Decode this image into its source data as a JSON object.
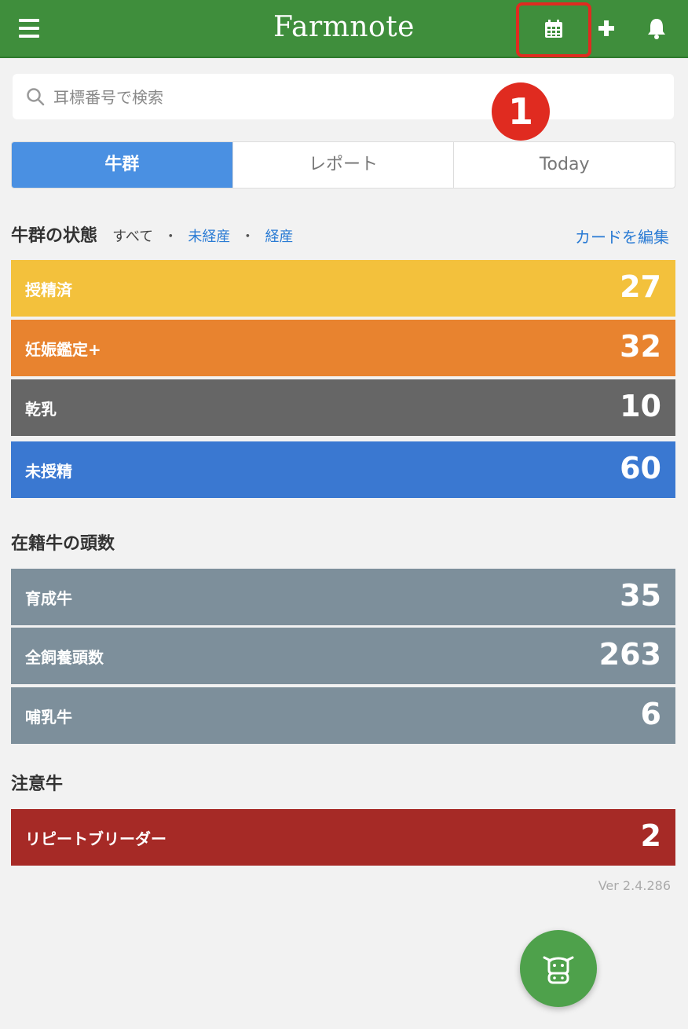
{
  "header": {
    "title": "Farmnote",
    "color": "#3f8e3c",
    "icons": [
      "menu-icon",
      "calendar-icon",
      "plus-icon",
      "bell-icon"
    ]
  },
  "search": {
    "placeholder": "耳標番号で検索"
  },
  "annotation": {
    "number": "1",
    "color": "#e02b20"
  },
  "tabs": [
    {
      "label": "牛群",
      "active": true
    },
    {
      "label": "レポート",
      "active": false
    },
    {
      "label": "Today",
      "active": false
    }
  ],
  "herd_status": {
    "title": "牛群の状態",
    "filters": {
      "current": "すべて",
      "sep": "・",
      "option1": "未経産",
      "option2": "経産"
    },
    "edit_label": "カードを編集",
    "cards": [
      {
        "label": "授精済",
        "value": "27",
        "color": "#f3c13c"
      },
      {
        "label": "妊娠鑑定+",
        "value": "32",
        "color": "#e8832f"
      },
      {
        "label": "乾乳",
        "value": "10",
        "color": "#666666"
      },
      {
        "label": "未授精",
        "value": "60",
        "color": "#3a78d1"
      }
    ]
  },
  "headcount": {
    "title": "在籍牛の頭数",
    "cards": [
      {
        "label": "育成牛",
        "value": "35",
        "color": "#7d8f9b"
      },
      {
        "label": "全飼養頭数",
        "value": "263",
        "color": "#7d8f9b"
      },
      {
        "label": "哺乳牛",
        "value": "6",
        "color": "#7d8f9b"
      }
    ]
  },
  "attention": {
    "title": "注意牛",
    "cards": [
      {
        "label": "リピートブリーダー",
        "value": "2",
        "color": "#a62a26"
      }
    ]
  },
  "version": "Ver 2.4.286",
  "fab": {
    "icon": "cow-icon",
    "color": "#4ea14b"
  }
}
